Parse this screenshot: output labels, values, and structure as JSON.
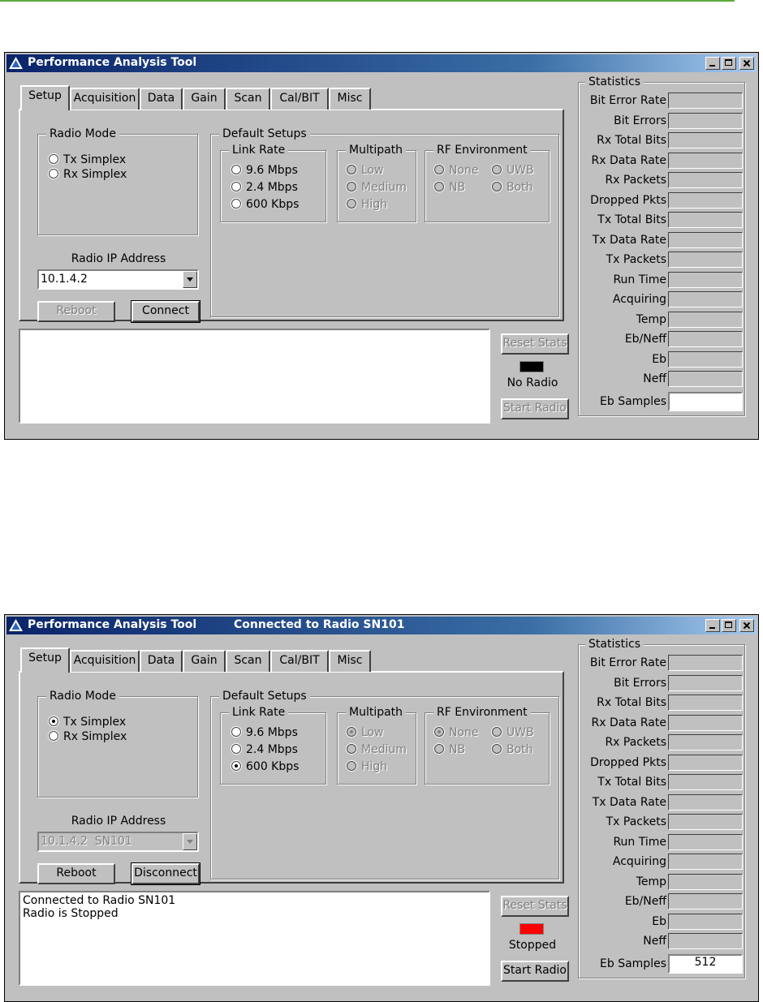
{
  "windows": [
    {
      "title": "Performance Analysis Tool",
      "status_title": "",
      "tabs": [
        "Setup",
        "Acquisition",
        "Data",
        "Gain",
        "Scan",
        "Cal/BIT",
        "Misc"
      ],
      "radio_mode": {
        "legend": "Radio Mode",
        "options": [
          {
            "label": "Tx Simplex",
            "selected": false,
            "disabled": false
          },
          {
            "label": "Rx Simplex",
            "selected": false,
            "disabled": false
          }
        ]
      },
      "default_setups": {
        "legend": "Default Setups"
      },
      "link_rate": {
        "legend": "Link Rate",
        "options": [
          {
            "label": "9.6 Mbps",
            "selected": false,
            "disabled": false
          },
          {
            "label": "2.4 Mbps",
            "selected": false,
            "disabled": false
          },
          {
            "label": "600 Kbps",
            "selected": false,
            "disabled": false
          }
        ]
      },
      "multipath": {
        "legend": "Multipath",
        "options": [
          {
            "label": "Low",
            "selected": false,
            "disabled": true
          },
          {
            "label": "Medium",
            "selected": false,
            "disabled": true
          },
          {
            "label": "High",
            "selected": false,
            "disabled": true
          }
        ]
      },
      "rf_environment": {
        "legend": "RF Environment",
        "options": [
          {
            "label": "None",
            "selected": false,
            "disabled": true
          },
          {
            "label": "UWB",
            "selected": false,
            "disabled": true
          },
          {
            "label": "NB",
            "selected": false,
            "disabled": true
          },
          {
            "label": "Both",
            "selected": false,
            "disabled": true
          }
        ]
      },
      "ip": {
        "label": "Radio IP Address",
        "value": "10.1.4.2",
        "disabled": false
      },
      "buttons": {
        "reboot": {
          "label": "Reboot",
          "disabled": true
        },
        "connect": {
          "label": "Connect",
          "disabled": false
        },
        "reset_stats": {
          "label": "Reset Stats",
          "disabled": true
        },
        "start_radio": {
          "label": "Start Radio",
          "disabled": true
        }
      },
      "log": [
        "",
        ""
      ],
      "radio_status": {
        "text": "No Radio",
        "color": "#000000"
      },
      "statistics": {
        "legend": "Statistics",
        "labels": [
          "Bit Error Rate",
          "Bit Errors",
          "Rx Total Bits",
          "Rx Data Rate",
          "Rx Packets",
          "Dropped Pkts",
          "Tx Total Bits",
          "Tx Data Rate",
          "Tx Packets",
          "Run Time",
          "Acquiring",
          "Temp",
          "Eb/Neff",
          "Eb",
          "Neff",
          "Eb Samples"
        ],
        "values": [
          "",
          "",
          "",
          "",
          "",
          "",
          "",
          "",
          "",
          "",
          "",
          "",
          "",
          "",
          "",
          ""
        ]
      }
    },
    {
      "title": "Performance Analysis Tool",
      "status_title": "Connected to Radio SN101",
      "tabs": [
        "Setup",
        "Acquisition",
        "Data",
        "Gain",
        "Scan",
        "Cal/BIT",
        "Misc"
      ],
      "radio_mode": {
        "legend": "Radio Mode",
        "options": [
          {
            "label": "Tx Simplex",
            "selected": true,
            "disabled": false
          },
          {
            "label": "Rx Simplex",
            "selected": false,
            "disabled": false
          }
        ]
      },
      "default_setups": {
        "legend": "Default Setups"
      },
      "link_rate": {
        "legend": "Link Rate",
        "options": [
          {
            "label": "9.6 Mbps",
            "selected": false,
            "disabled": false
          },
          {
            "label": "2.4 Mbps",
            "selected": false,
            "disabled": false
          },
          {
            "label": "600 Kbps",
            "selected": true,
            "disabled": false
          }
        ]
      },
      "multipath": {
        "legend": "Multipath",
        "options": [
          {
            "label": "Low",
            "selected": true,
            "disabled": true
          },
          {
            "label": "Medium",
            "selected": false,
            "disabled": true
          },
          {
            "label": "High",
            "selected": false,
            "disabled": true
          }
        ]
      },
      "rf_environment": {
        "legend": "RF Environment",
        "options": [
          {
            "label": "None",
            "selected": true,
            "disabled": true
          },
          {
            "label": "UWB",
            "selected": false,
            "disabled": true
          },
          {
            "label": "NB",
            "selected": false,
            "disabled": true
          },
          {
            "label": "Both",
            "selected": false,
            "disabled": true
          }
        ]
      },
      "ip": {
        "label": "Radio IP Address",
        "value": "10.1.4.2  SN101",
        "disabled": true
      },
      "buttons": {
        "reboot": {
          "label": "Reboot",
          "disabled": false
        },
        "connect": {
          "label": "Disconnect",
          "disabled": false
        },
        "reset_stats": {
          "label": "Reset Stats",
          "disabled": true
        },
        "start_radio": {
          "label": "Start Radio",
          "disabled": false
        }
      },
      "log": [
        "Connected to Radio SN101",
        "Radio is Stopped"
      ],
      "radio_status": {
        "text": "Stopped",
        "color": "#ff0000"
      },
      "statistics": {
        "legend": "Statistics",
        "labels": [
          "Bit Error Rate",
          "Bit Errors",
          "Rx Total Bits",
          "Rx Data Rate",
          "Rx Packets",
          "Dropped Pkts",
          "Tx Total Bits",
          "Tx Data Rate",
          "Tx Packets",
          "Run Time",
          "Acquiring",
          "Temp",
          "Eb/Neff",
          "Eb",
          "Neff",
          "Eb Samples"
        ],
        "values": [
          "",
          "",
          "",
          "",
          "",
          "",
          "",
          "",
          "",
          "",
          "",
          "",
          "",
          "",
          "",
          "512"
        ]
      }
    }
  ]
}
